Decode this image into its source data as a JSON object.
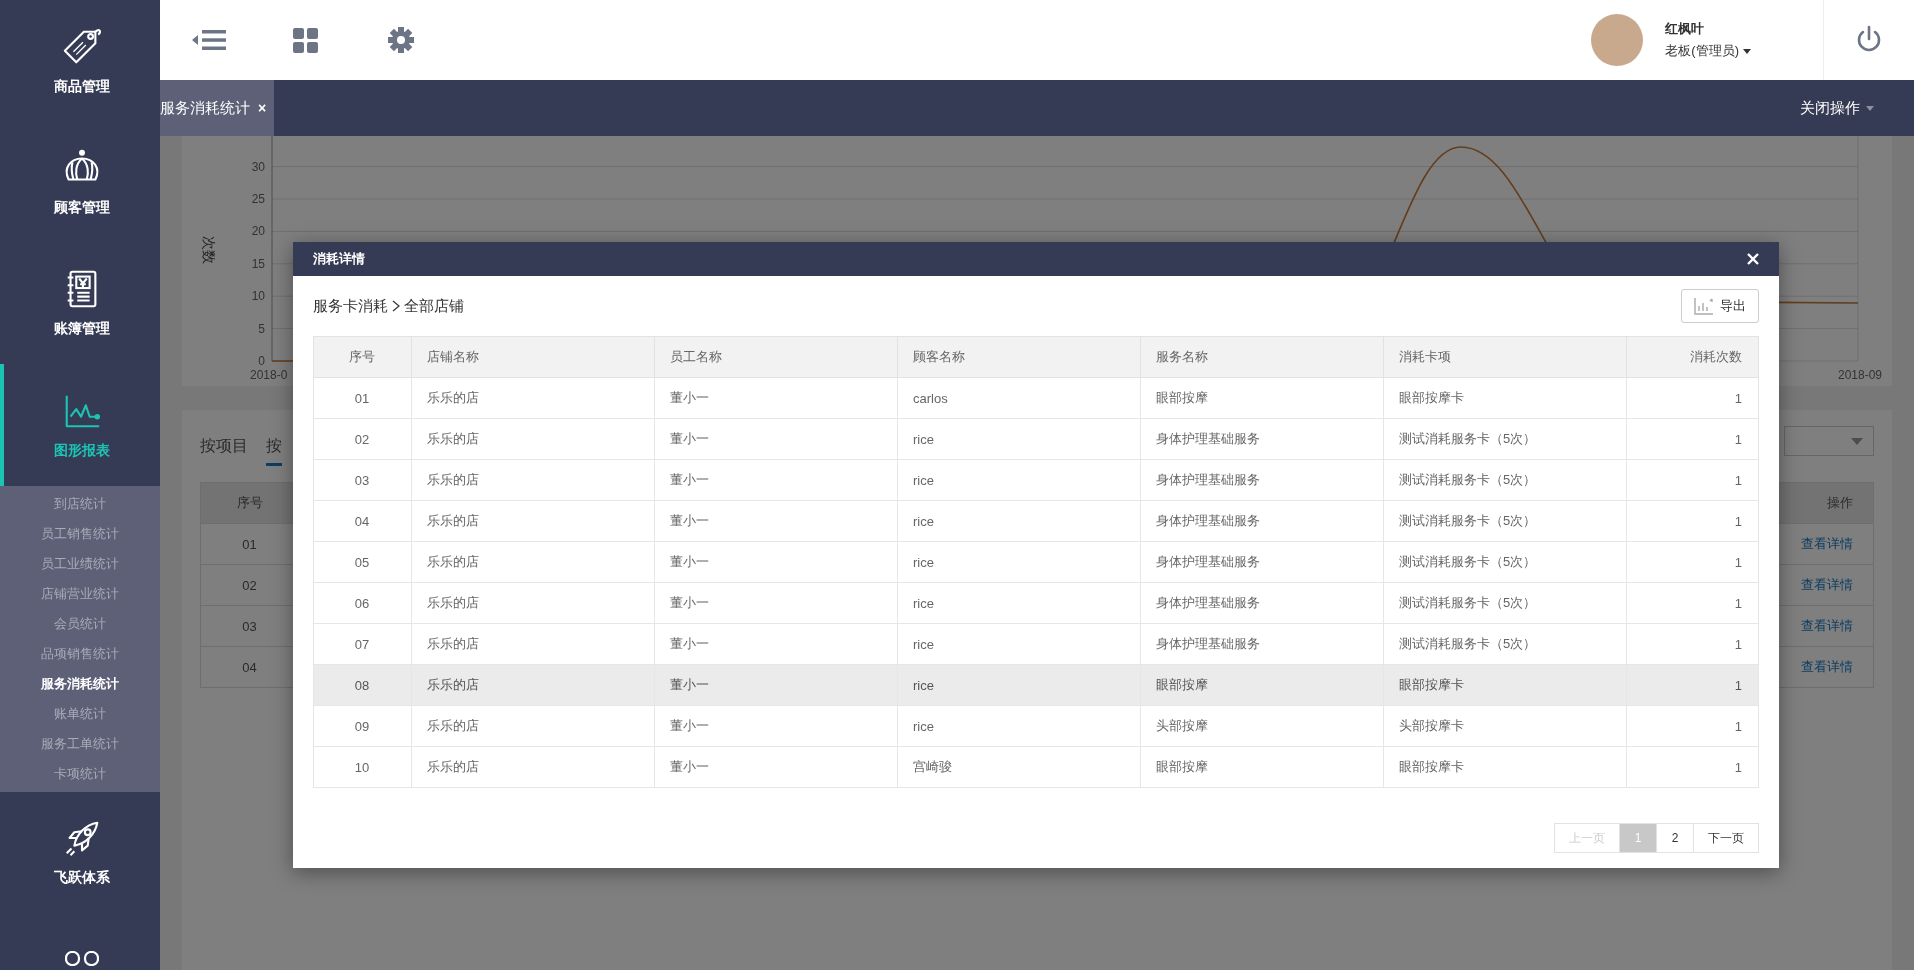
{
  "sidebar": {
    "items": [
      {
        "kind": "tag",
        "label": "商品管理",
        "selected": false
      },
      {
        "kind": "crown",
        "label": "顾客管理",
        "selected": false
      },
      {
        "kind": "ledger",
        "label": "账簿管理",
        "selected": false
      },
      {
        "kind": "chart",
        "label": "图形报表",
        "selected": true,
        "expanded": true,
        "children": [
          {
            "label": "到店统计",
            "selected": false
          },
          {
            "label": "员工销售统计",
            "selected": false
          },
          {
            "label": "员工业绩统计",
            "selected": false
          },
          {
            "label": "店铺营业统计",
            "selected": false
          },
          {
            "label": "会员统计",
            "selected": false
          },
          {
            "label": "品项销售统计",
            "selected": false
          },
          {
            "label": "服务消耗统计",
            "selected": true
          },
          {
            "label": "账单统计",
            "selected": false
          },
          {
            "label": "服务工单统计",
            "selected": false
          },
          {
            "label": "卡项统计",
            "selected": false
          }
        ]
      },
      {
        "kind": "rocket",
        "label": "飞跃体系",
        "selected": false
      },
      {
        "kind": "group",
        "selected": false
      }
    ]
  },
  "header": {
    "user": {
      "name": "红枫叶",
      "role": "老板(管理员)"
    }
  },
  "tabs": [
    {
      "label": "服务消耗统计",
      "close": "×",
      "selected": true
    }
  ],
  "close_menu": "关闭操作",
  "background": {
    "chart": {
      "ylabel": "次数",
      "yticks": [
        "30",
        "25",
        "20",
        "15",
        "10",
        "5",
        "0"
      ],
      "xlabels": [
        "2018-0",
        "2018-09"
      ]
    },
    "filter_tabs": [
      {
        "label": "按项目",
        "selected": false
      },
      {
        "label": "按",
        "selected": true
      }
    ],
    "table": {
      "columns": [
        "序号",
        "操作"
      ],
      "rows": [
        {
          "index": "01",
          "action": "查看详情"
        },
        {
          "index": "02",
          "action": "查看详情"
        },
        {
          "index": "03",
          "action": "查看详情"
        },
        {
          "index": "04",
          "action": "查看详情"
        }
      ]
    }
  },
  "modal": {
    "title": "消耗详情",
    "breadcrumb": [
      "服务卡消耗",
      "全部店铺"
    ],
    "export": "导出",
    "columns": [
      "序号",
      "店铺名称",
      "员工名称",
      "顾客名称",
      "服务名称",
      "消耗卡项",
      "消耗次数"
    ],
    "rows": [
      {
        "index": "01",
        "shop": "乐乐的店",
        "staff": "董小一",
        "customer": "carlos",
        "service": "眼部按摩",
        "card": "眼部按摩卡",
        "count": "1",
        "hovered": false
      },
      {
        "index": "02",
        "shop": "乐乐的店",
        "staff": "董小一",
        "customer": "rice",
        "service": "身体护理基础服务",
        "card": "测试消耗服务卡（5次）",
        "count": "1",
        "hovered": false
      },
      {
        "index": "03",
        "shop": "乐乐的店",
        "staff": "董小一",
        "customer": "rice",
        "service": "身体护理基础服务",
        "card": "测试消耗服务卡（5次）",
        "count": "1",
        "hovered": false
      },
      {
        "index": "04",
        "shop": "乐乐的店",
        "staff": "董小一",
        "customer": "rice",
        "service": "身体护理基础服务",
        "card": "测试消耗服务卡（5次）",
        "count": "1",
        "hovered": false
      },
      {
        "index": "05",
        "shop": "乐乐的店",
        "staff": "董小一",
        "customer": "rice",
        "service": "身体护理基础服务",
        "card": "测试消耗服务卡（5次）",
        "count": "1",
        "hovered": false
      },
      {
        "index": "06",
        "shop": "乐乐的店",
        "staff": "董小一",
        "customer": "rice",
        "service": "身体护理基础服务",
        "card": "测试消耗服务卡（5次）",
        "count": "1",
        "hovered": false
      },
      {
        "index": "07",
        "shop": "乐乐的店",
        "staff": "董小一",
        "customer": "rice",
        "service": "身体护理基础服务",
        "card": "测试消耗服务卡（5次）",
        "count": "1",
        "hovered": false
      },
      {
        "index": "08",
        "shop": "乐乐的店",
        "staff": "董小一",
        "customer": "rice",
        "service": "眼部按摩",
        "card": "眼部按摩卡",
        "count": "1",
        "hovered": true
      },
      {
        "index": "09",
        "shop": "乐乐的店",
        "staff": "董小一",
        "customer": "rice",
        "service": "头部按摩",
        "card": "头部按摩卡",
        "count": "1",
        "hovered": false
      },
      {
        "index": "10",
        "shop": "乐乐的店",
        "staff": "董小一",
        "customer": "宫崎骏",
        "service": "眼部按摩",
        "card": "眼部按摩卡",
        "count": "1",
        "hovered": false
      }
    ],
    "pagination": {
      "prev": {
        "label": "上一页",
        "disabled": true
      },
      "pages": [
        {
          "label": "1",
          "selected": true
        },
        {
          "label": "2",
          "selected": false
        }
      ],
      "next": {
        "label": "下一页",
        "disabled": false
      }
    }
  }
}
